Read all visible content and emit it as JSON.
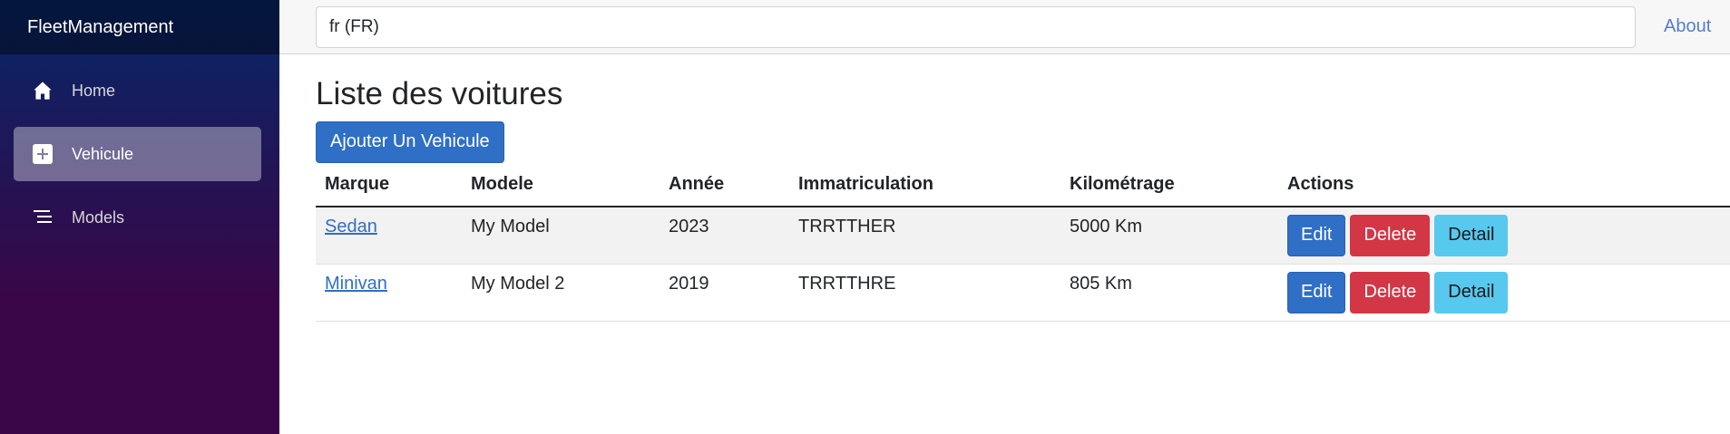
{
  "app": {
    "brand": "FleetManagement"
  },
  "sidebar": {
    "items": [
      {
        "label": "Home",
        "icon": "home-icon",
        "active": false
      },
      {
        "label": "Vehicule",
        "icon": "plus-icon",
        "active": true
      },
      {
        "label": "Models",
        "icon": "list-icon",
        "active": false
      }
    ]
  },
  "topbar": {
    "culture_value": "fr (FR)",
    "about_label": "About"
  },
  "page": {
    "title": "Liste des voitures",
    "add_button": "Ajouter Un Vehicule"
  },
  "table": {
    "headers": [
      "Marque",
      "Modele",
      "Année",
      "Immatriculation",
      "Kilométrage",
      "Actions"
    ],
    "rows": [
      {
        "marque": "Sedan",
        "modele": "My Model",
        "annee": "2023",
        "immatriculation": "TRRTTHER",
        "kilometrage": "5000 Km"
      },
      {
        "marque": "Minivan",
        "modele": "My Model 2",
        "annee": "2019",
        "immatriculation": "TRRTTHRE",
        "kilometrage": "805 Km"
      }
    ],
    "action_labels": {
      "edit": "Edit",
      "delete": "Delete",
      "detail": "Detail"
    }
  },
  "colors": {
    "primary": "#2f6fc6",
    "danger": "#d33645",
    "info": "#57c8ee"
  }
}
